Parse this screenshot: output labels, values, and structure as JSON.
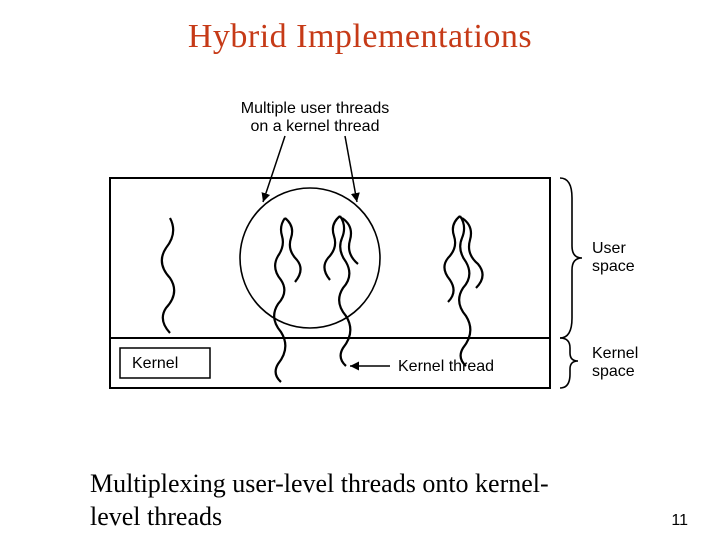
{
  "title": "Hybrid Implementations",
  "top_label_line1": "Multiple user threads",
  "top_label_line2": "on a kernel thread",
  "kernel_label": "Kernel",
  "kernel_thread_label": "Kernel thread",
  "user_space_label_line1": "User",
  "user_space_label_line2": "space",
  "kernel_space_label_line1": "Kernel",
  "kernel_space_label_line2": "space",
  "caption_line1": "Multiplexing user-level threads onto kernel-",
  "caption_line2": "level threads",
  "page_number": "11"
}
